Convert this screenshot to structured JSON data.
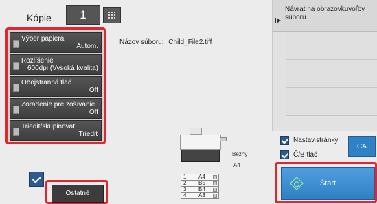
{
  "copies": {
    "label": "Kópie",
    "value": "1"
  },
  "settings": [
    {
      "id": "paper",
      "label": "Výber papiera",
      "value": "Autom."
    },
    {
      "id": "resolution",
      "label": "Rozlíšenie",
      "value": "600dpi (Vysoká kvalita)"
    },
    {
      "id": "duplex",
      "label": "Obojstranná tlač",
      "value": "Off"
    },
    {
      "id": "staple",
      "label": "Zoradenie pre zošívanie",
      "value": "Off"
    },
    {
      "id": "sort",
      "label": "Triedit/skupinovat",
      "value": "Triediť"
    }
  ],
  "filename": {
    "label": "Názov súboru:",
    "value": "Child_File2.tiff"
  },
  "right_panel": {
    "return_label": "Návrat na obrazovkuvoľby súboru"
  },
  "machine": {
    "output_label": "Bežný",
    "tray_label": "A4",
    "trays": [
      {
        "number": "1",
        "size": "A4"
      },
      {
        "number": "2",
        "size": "B5"
      },
      {
        "number": "3",
        "size": "B4"
      },
      {
        "number": "4",
        "size": "A3"
      }
    ]
  },
  "options": {
    "page_setting": "Nastav.stránky",
    "bw_print": "Č/B tlač"
  },
  "buttons": {
    "ca": "CA",
    "start": "Štart",
    "other": "Ostatné"
  }
}
